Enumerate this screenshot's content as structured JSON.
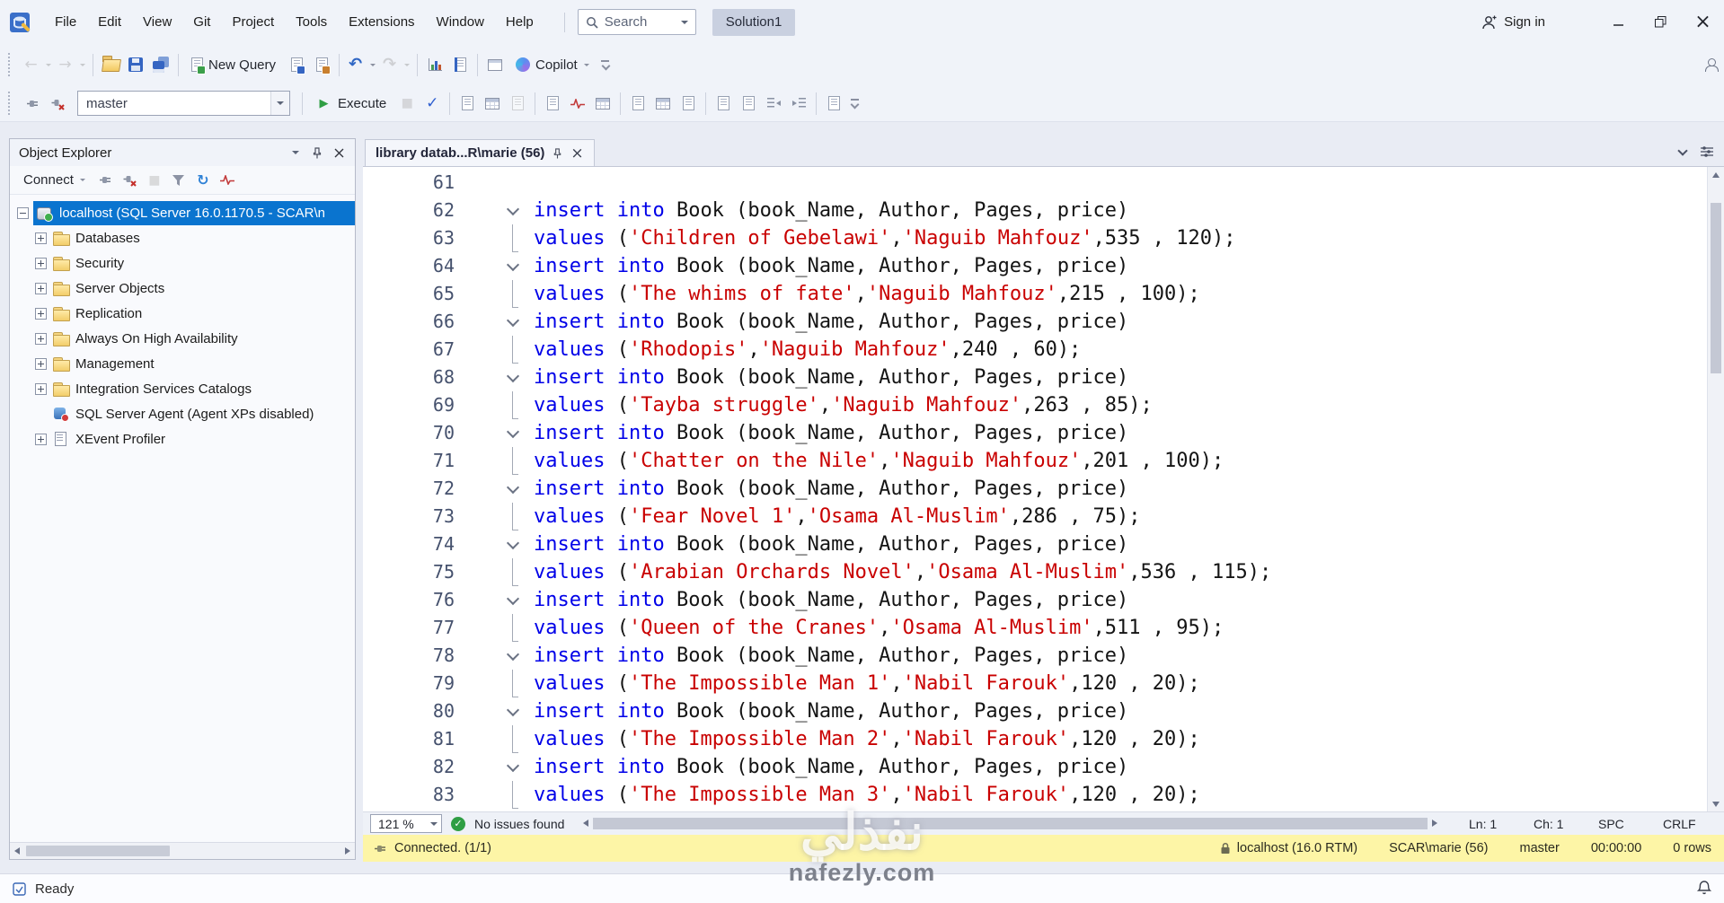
{
  "titlebar": {
    "menus": [
      "File",
      "Edit",
      "View",
      "Git",
      "Project",
      "Tools",
      "Extensions",
      "Window",
      "Help"
    ],
    "search_label": "Search",
    "solution": "Solution1",
    "sign_in": "Sign in"
  },
  "toolbar_main_items": [
    {
      "t": "grip"
    },
    {
      "n": "navigate-back",
      "g": "arrow-left",
      "dis": 1,
      "drop": 1
    },
    {
      "n": "navigate-forward",
      "g": "arrow-right",
      "dis": 1,
      "drop": 1
    },
    {
      "t": "sep"
    },
    {
      "n": "open-file",
      "g": "folder-open"
    },
    {
      "n": "save",
      "g": "floppy"
    },
    {
      "n": "save-all",
      "g": "floppy-all"
    },
    {
      "t": "sep"
    },
    {
      "n": "new-query",
      "g": "doc-query",
      "label": "New Query"
    },
    {
      "n": "database-engine-query",
      "g": "doc-db"
    },
    {
      "n": "analysis-services-query",
      "g": "doc-cube"
    },
    {
      "t": "sep"
    },
    {
      "n": "undo",
      "g": "undo",
      "drop": 1
    },
    {
      "n": "redo",
      "g": "redo",
      "dis": 1,
      "drop": 1
    },
    {
      "t": "sep"
    },
    {
      "n": "activity-monitor",
      "g": "chart"
    },
    {
      "n": "registered-servers",
      "g": "notebook"
    },
    {
      "t": "sep"
    },
    {
      "n": "template-browser",
      "g": "table"
    },
    {
      "n": "copilot",
      "g": "copilot",
      "label": "Copilot",
      "drop": 1
    },
    {
      "t": "overflow"
    },
    {
      "t": "spacer"
    },
    {
      "n": "send-feedback",
      "g": "person-pencil"
    }
  ],
  "toolbar_sql_items": [
    {
      "t": "grip"
    },
    {
      "n": "connect-object-explorer",
      "g": "plug"
    },
    {
      "n": "change-connection",
      "g": "plug-x"
    },
    {
      "t": "combo",
      "n": "database",
      "value": "master"
    },
    {
      "t": "sep"
    },
    {
      "n": "execute",
      "g": "play",
      "label": "Execute"
    },
    {
      "n": "cancel-executing-query",
      "g": "stop",
      "dis": 1
    },
    {
      "n": "parse",
      "g": "check"
    },
    {
      "t": "sep"
    },
    {
      "n": "display-estimated-plan",
      "g": "doc-gray"
    },
    {
      "n": "query-options",
      "g": "grid"
    },
    {
      "n": "intellisense-enabled",
      "g": "doc-gray",
      "dis": 1
    },
    {
      "t": "sep"
    },
    {
      "n": "include-actual-plan",
      "g": "doc-gray"
    },
    {
      "n": "include-live-statistics",
      "g": "pulse"
    },
    {
      "n": "include-client-statistics",
      "g": "grid"
    },
    {
      "t": "sep"
    },
    {
      "n": "results-to-text",
      "g": "doc-gray"
    },
    {
      "n": "results-to-grid",
      "g": "grid"
    },
    {
      "n": "results-to-file",
      "g": "doc-gray"
    },
    {
      "t": "sep"
    },
    {
      "n": "comment-selection",
      "g": "doc-gray"
    },
    {
      "n": "uncomment-selection",
      "g": "doc-gray"
    },
    {
      "n": "decrease-indent",
      "g": "outdent"
    },
    {
      "n": "increase-indent",
      "g": "indent"
    },
    {
      "t": "sep"
    },
    {
      "n": "specify-template-values",
      "g": "doc-gray"
    },
    {
      "t": "overflow"
    }
  ],
  "object_explorer": {
    "title": "Object Explorer",
    "server": "localhost (SQL Server 16.0.1170.5 - SCAR\\n",
    "toolbar": [
      {
        "n": "connect",
        "label": "Connect",
        "drop": 1
      },
      {
        "n": "oe-connect",
        "g": "plug"
      },
      {
        "n": "oe-disconnect",
        "g": "plug-x"
      },
      {
        "n": "oe-stop",
        "g": "stop",
        "dis": 1
      },
      {
        "n": "oe-filter",
        "g": "funnel"
      },
      {
        "n": "oe-refresh",
        "g": "refresh"
      },
      {
        "n": "oe-activity",
        "g": "pulse"
      }
    ],
    "items": [
      {
        "label": "Databases",
        "icon": "folder",
        "box": "plus"
      },
      {
        "label": "Security",
        "icon": "folder",
        "box": "plus"
      },
      {
        "label": "Server Objects",
        "icon": "folder",
        "box": "plus"
      },
      {
        "label": "Replication",
        "icon": "folder",
        "box": "plus"
      },
      {
        "label": "Always On High Availability",
        "icon": "folder",
        "box": "plus"
      },
      {
        "label": "Management",
        "icon": "folder",
        "box": "plus"
      },
      {
        "label": "Integration Services Catalogs",
        "icon": "folder",
        "box": "plus"
      },
      {
        "label": "SQL Server Agent (Agent XPs disabled)",
        "icon": "agent",
        "box": "none"
      },
      {
        "label": "XEvent Profiler",
        "icon": "xevent",
        "box": "plus"
      }
    ]
  },
  "editor": {
    "tab": "library datab...R\\marie (56)",
    "zoom": "121 %",
    "issues": "No issues found",
    "ln": "Ln: 1",
    "ch": "Ch: 1",
    "ins_mode": "SPC",
    "eol": "CRLF",
    "code": {
      "first_line_number": 61,
      "insert_keyword": "insert into",
      "insert_rest": " Book (book_Name, Author, Pages, price)",
      "values_keyword": "values",
      "rows": [
        {
          "book": "Children of Gebelawi",
          "author": "Naguib Mahfouz",
          "pages": "535",
          "price": "120"
        },
        {
          "book": "The whims of fate",
          "author": "Naguib Mahfouz",
          "pages": "215",
          "price": "100"
        },
        {
          "book": "Rhodopis",
          "author": "Naguib Mahfouz",
          "pages": "240",
          "price": "60"
        },
        {
          "book": "Tayba struggle",
          "author": "Naguib Mahfouz",
          "pages": "263",
          "price": "85"
        },
        {
          "book": "Chatter on the Nile",
          "author": "Naguib Mahfouz",
          "pages": "201",
          "price": "100"
        },
        {
          "book": "Fear Novel 1",
          "author": "Osama Al-Muslim",
          "pages": "286",
          "price": "75"
        },
        {
          "book": "Arabian Orchards Novel",
          "author": "Osama Al-Muslim",
          "pages": "536",
          "price": "115"
        },
        {
          "book": "Queen of the Cranes",
          "author": "Osama Al-Muslim",
          "pages": "511",
          "price": "95"
        },
        {
          "book": "The Impossible Man 1",
          "author": "Nabil Farouk",
          "pages": "120",
          "price": "20"
        },
        {
          "book": "The Impossible Man 2",
          "author": "Nabil Farouk",
          "pages": "120",
          "price": "20"
        },
        {
          "book": "The Impossible Man 3",
          "author": "Nabil Farouk",
          "pages": "120",
          "price": "20"
        }
      ]
    }
  },
  "connection_bar": {
    "status": "Connected. (1/1)",
    "server": "localhost (16.0 RTM)",
    "user": "SCAR\\marie (56)",
    "database": "master",
    "elapsed": "00:00:00",
    "rows": "0 rows"
  },
  "app_statusbar": {
    "ready": "Ready"
  },
  "watermark": {
    "logo_text": "نفذلي",
    "site": "nafezly.com"
  },
  "colors": {
    "selection_blue": "#0a74cf",
    "keyword_blue": "#0000e8",
    "string_red": "#c90000",
    "execute_green": "#2f9e44",
    "connected_yellow": "#fdf5a6"
  }
}
